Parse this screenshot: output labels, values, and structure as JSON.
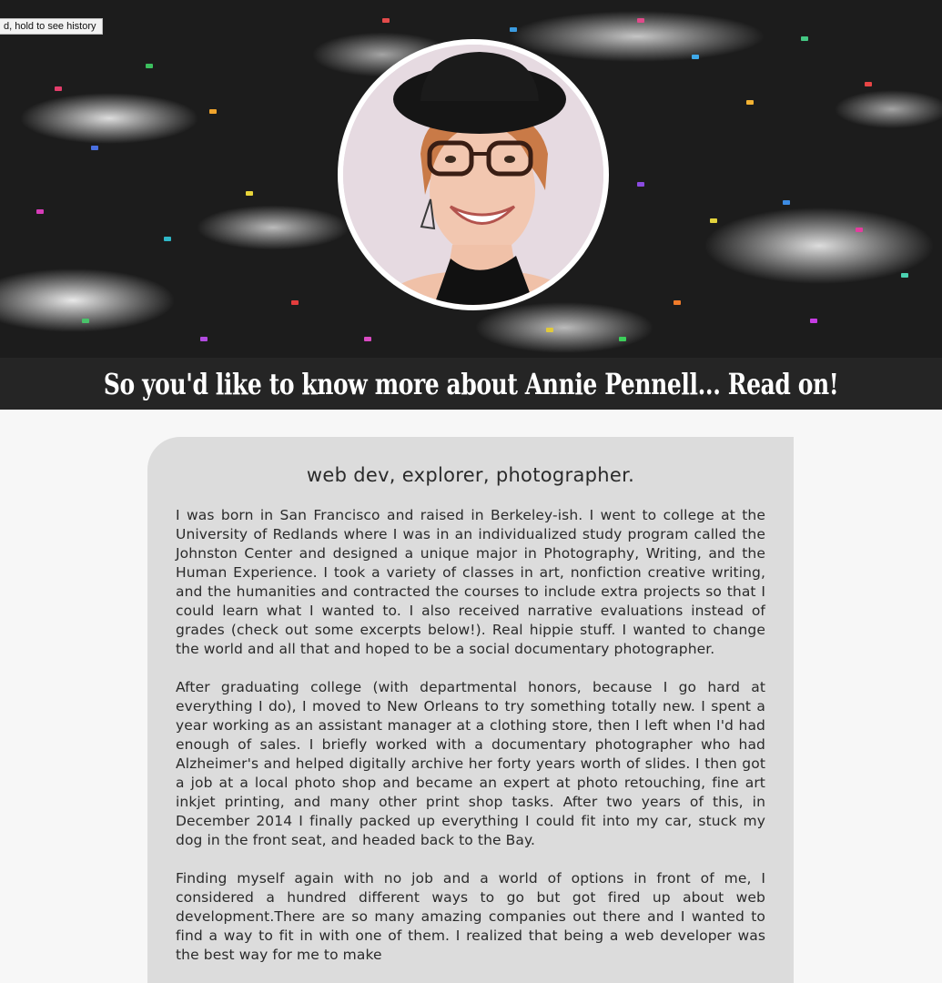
{
  "tooltip": {
    "text": "d, hold to see history"
  },
  "header": {
    "title": "So you'd like to know more about Annie Pennell... Read on!"
  },
  "avatar": {
    "alt": "Annie Pennell portrait"
  },
  "about": {
    "tagline": "web dev, explorer, photographer.",
    "paragraphs": [
      "I was born in San Francisco and raised in Berkeley-ish. I went to college at the University of Redlands where I was in an individualized study program called the Johnston Center and designed a unique major in Photography, Writing, and the Human Experience. I took a variety of classes in art, nonfiction creative writing, and the humanities and contracted the courses to include extra projects so that I could learn what I wanted to. I also received narrative evaluations instead of grades (check out some excerpts below!). Real hippie stuff. I wanted to change the world and all that and hoped to be a social documentary photographer.",
      "After graduating college (with departmental honors, because I go hard at everything I do), I moved to New Orleans to try something totally new. I spent a year working as an assistant manager at a clothing store, then I left when I'd had enough of sales. I briefly worked with a documentary photographer who had Alzheimer's and helped digitally archive her forty years worth of slides. I then got a job at a local photo shop and became an expert at photo retouching, fine art inkjet printing, and many other print shop tasks. After two years of this, in December 2014 I finally packed up everything I could fit into my car, stuck my dog in the front seat, and headed back to the Bay.",
      "Finding myself again with no job and a world of options in front of me, I considered a hundred different ways to go but got fired up about web development.There are so many amazing companies out there and I wanted to find a way to fit in with one of them. I realized that being a web developer was the best way for me to make"
    ]
  },
  "colors": {
    "banner_bg": "#282828",
    "card_bg": "#dcdcdc",
    "page_bg": "#f7f7f7"
  }
}
